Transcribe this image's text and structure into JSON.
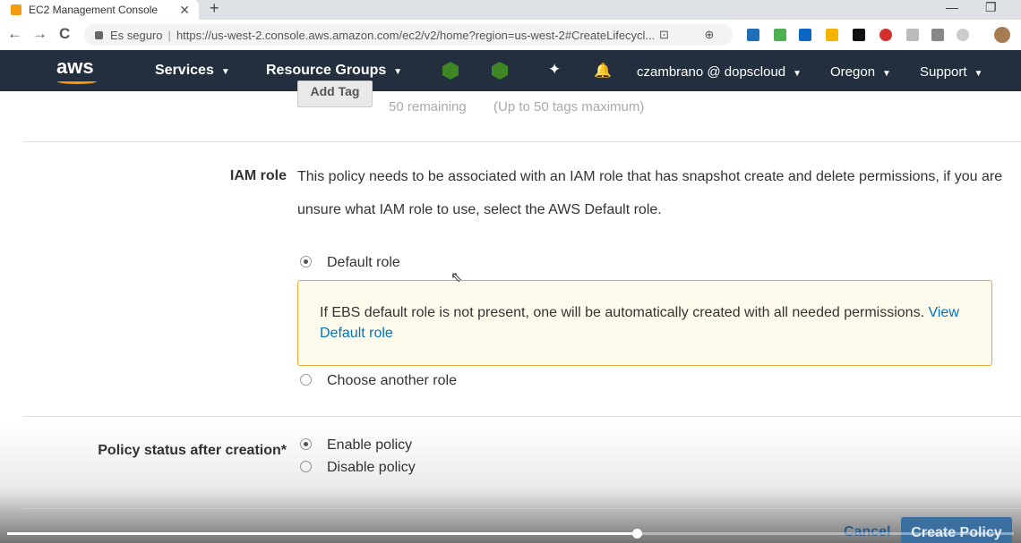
{
  "browser": {
    "tab_title": "EC2 Management Console",
    "tab_close": "✕",
    "new_tab": "+",
    "minimize": "—",
    "restore": "❐",
    "back": "←",
    "forward": "→",
    "reload": "C",
    "security_text": "Es seguro",
    "url": "https://us-west-2.console.aws.amazon.com/ec2/v2/home?region=us-west-2#CreateLifecycl...",
    "omnibox_icons": "⊡ ⊕ ☆"
  },
  "aws_nav": {
    "logo": "aws",
    "services": "Services",
    "resource_groups": "Resource Groups",
    "user": "czambrano @ dopscloud",
    "region": "Oregon",
    "support": "Support",
    "caret": "▼",
    "pin_icon": "✦",
    "bell_icon": "🔔",
    "colors": {
      "bar": "#232f3e",
      "accent": "#ff9900",
      "hex_icon": "#3f8624"
    }
  },
  "tags": {
    "add_tag_button": "Add Tag",
    "remaining": "50 remaining",
    "limit_note": "(Up to 50 tags maximum)"
  },
  "iam_role": {
    "label": "IAM role",
    "description": "This policy needs to be associated with an IAM role that has snapshot create and delete permissions, if you are unsure what IAM role to use, select the AWS Default role.",
    "options": [
      {
        "label": "Default role",
        "selected": true
      },
      {
        "label": "Choose another role",
        "selected": false
      }
    ],
    "notice_text": "If EBS default role is not present, one will be automatically created with all needed permissions.",
    "notice_link": "View Default role"
  },
  "policy_status": {
    "label": "Policy status after creation*",
    "options": [
      {
        "label": "Enable policy",
        "selected": true
      },
      {
        "label": "Disable policy",
        "selected": false
      }
    ]
  },
  "footer": {
    "cancel": "Cancel",
    "create": "Create Policy"
  },
  "video": {
    "progress": 0.625
  }
}
